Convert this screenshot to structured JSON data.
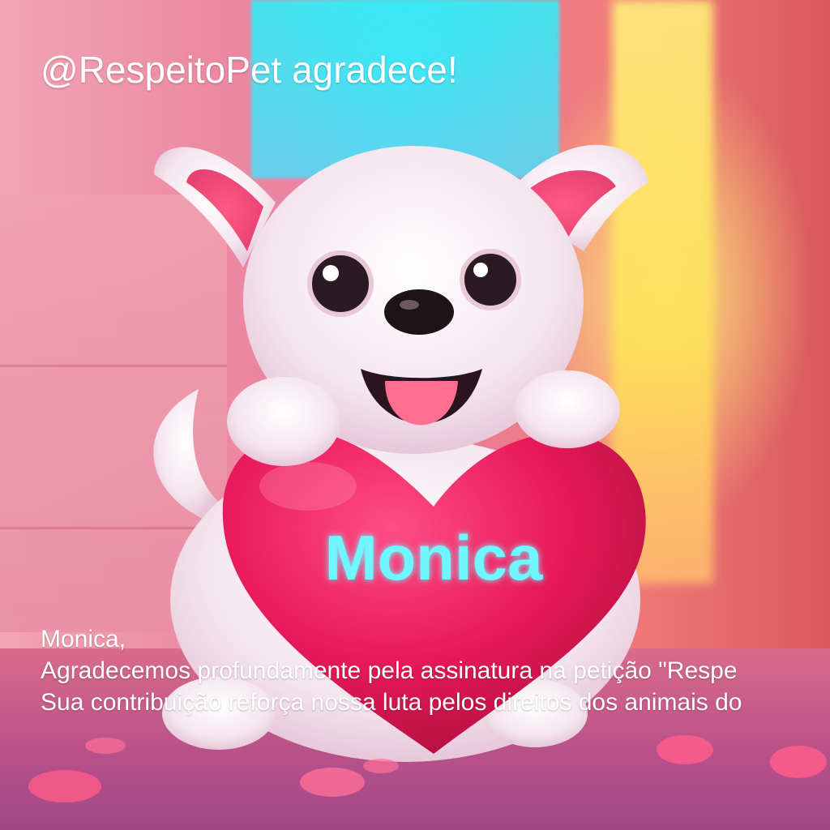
{
  "header": {
    "title": "@RespeitoPet agradece!"
  },
  "heart": {
    "name_text": "Monica"
  },
  "message": {
    "greeting": "Monica,",
    "line1": "Agradecemos profundamente pela assinatura na petição \"Respe",
    "line2": "Sua contribuição reforça nossa luta pelos direitos dos animais do"
  },
  "colors": {
    "heart": "#e8195a",
    "name_glow": "#6ff6ff",
    "text": "#ffffff"
  }
}
